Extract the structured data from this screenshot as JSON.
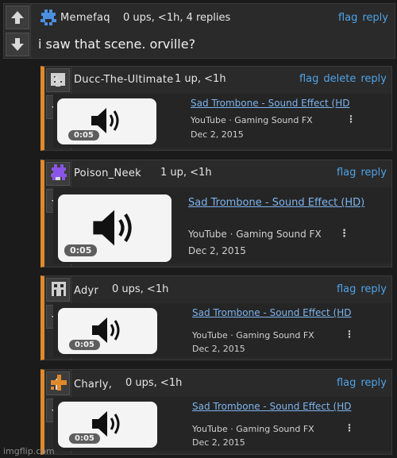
{
  "icons": {
    "upvote": "arrow-up-icon",
    "downvote": "arrow-down-icon",
    "speaker": "speaker-icon"
  },
  "colors": {
    "link": "#4ea3e8",
    "reply_bar": "#e0892a",
    "video_title": "#7db4ee"
  },
  "top_comment": {
    "username": "Memefaq",
    "meta": "0 ups, <1h, 4 replies",
    "actions": [
      "flag",
      "reply"
    ],
    "text": "i saw that scene. orville?"
  },
  "replies": [
    {
      "username": "Ducc-The-Ultimate",
      "meta": "1 up, <1h",
      "actions": [
        "flag",
        "delete",
        "reply"
      ],
      "video": {
        "title": "Sad Trombone - Sound Effect (HD",
        "source": "YouTube · Gaming Sound FX",
        "date": "Dec 2, 2015",
        "duration": "0:05",
        "kebab": "⋮"
      }
    },
    {
      "username": "Poison_Neek",
      "meta": "1 up, <1h",
      "actions": [
        "flag",
        "reply"
      ],
      "video": {
        "title": "Sad Trombone - Sound Effect (HD)",
        "source": "YouTube · Gaming Sound FX",
        "date": "Dec 2, 2015",
        "duration": "0:05",
        "kebab": "⋮"
      }
    },
    {
      "username": "Adyr",
      "meta": "0 ups, <1h",
      "actions": [
        "flag",
        "reply"
      ],
      "video": {
        "title": "Sad Trombone - Sound Effect (HD",
        "source": "YouTube · Gaming Sound FX",
        "date": "Dec 2, 2015",
        "duration": "0:05",
        "kebab": "⋮"
      }
    },
    {
      "username": "Charly,",
      "meta": "0 ups, <1h",
      "actions": [
        "flag",
        "reply"
      ],
      "video": {
        "title": "Sad Trombone - Sound Effect (HD",
        "source": "YouTube · Gaming Sound FX",
        "date": "Dec 2, 2015",
        "duration": "0:05",
        "kebab": "⋮"
      }
    }
  ],
  "watermark": "imgflip.com"
}
